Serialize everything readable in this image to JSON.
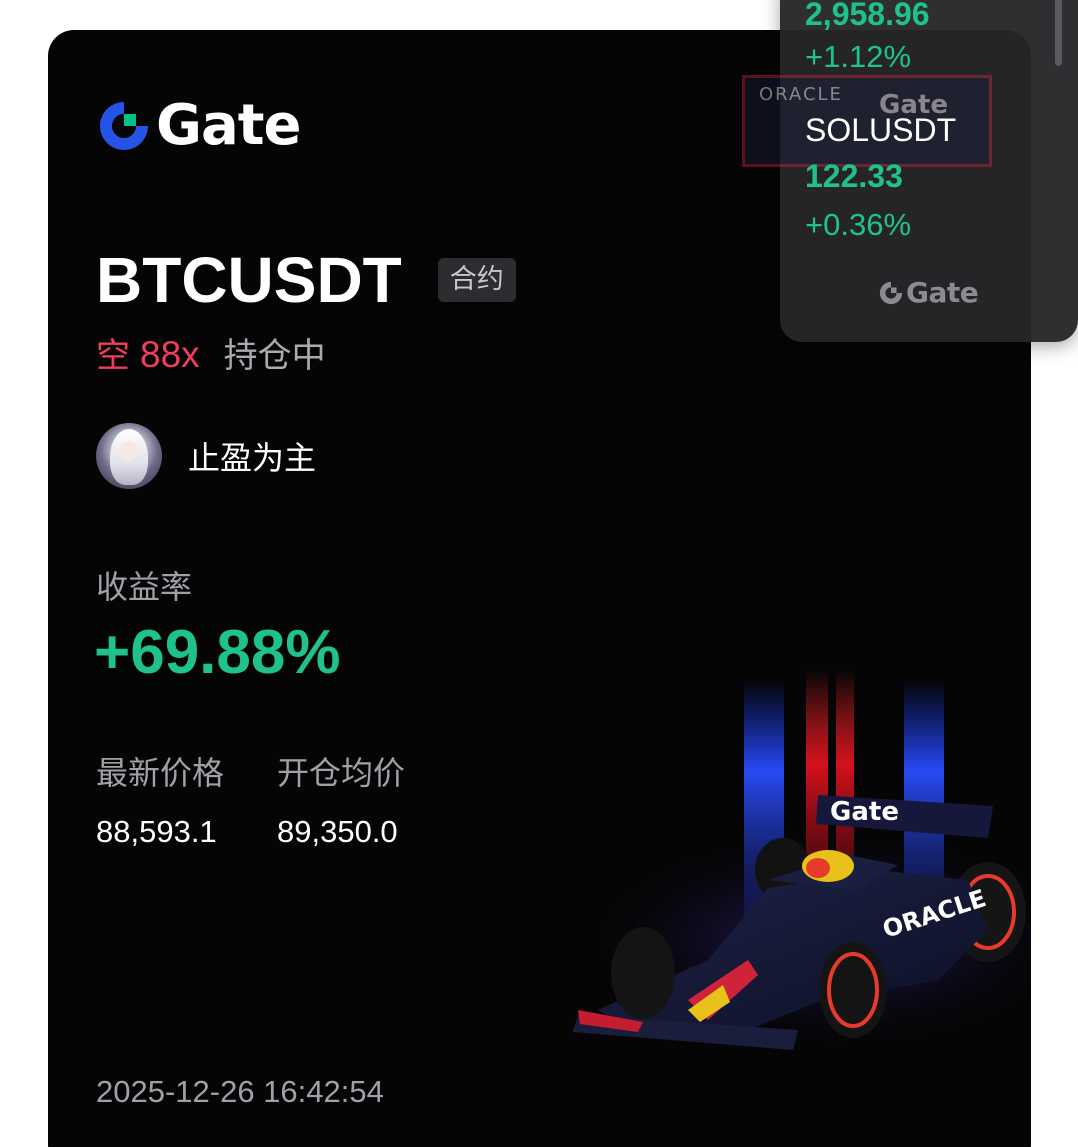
{
  "brand": {
    "name": "Gate",
    "color": "#2354e6",
    "accent": "#00c08b"
  },
  "position": {
    "symbol": "BTCUSDT",
    "type_badge": "合约",
    "side": "空",
    "leverage": "88x",
    "status": "持仓中"
  },
  "user": {
    "name": "止盈为主"
  },
  "roi": {
    "label": "收益率",
    "value": "+69.88%"
  },
  "prices": {
    "last_label": "最新价格",
    "last_value": "88,593.1",
    "open_label": "开仓均价",
    "open_value": "89,350.0"
  },
  "timestamp": "2025-12-26 16:42:54",
  "ticker_panel": {
    "items": [
      {
        "symbol": "",
        "price": "2,958.96",
        "change": "+1.12%"
      },
      {
        "symbol": "SOLUSDT",
        "price": "122.33",
        "change": "+0.36%"
      }
    ],
    "sponsor_text": "ORACLE",
    "sponsor_logo": "Gate",
    "footer_logo": "Gate"
  },
  "colors": {
    "positive": "#1fc28a",
    "short": "#ef3e5c",
    "muted": "#9ea1a7",
    "card_bg": "#050506"
  }
}
